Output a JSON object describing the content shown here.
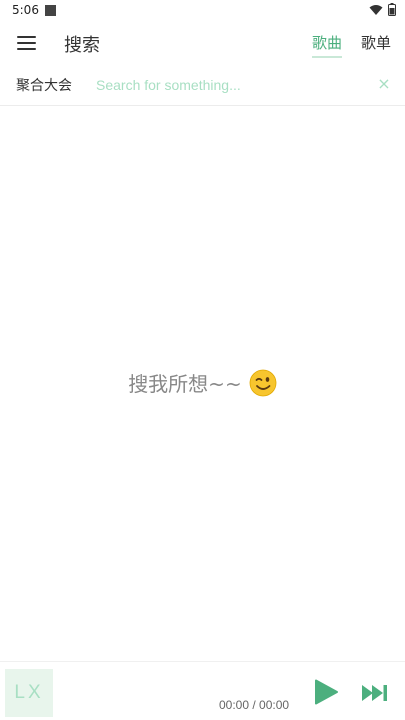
{
  "status_bar": {
    "time": "5:06"
  },
  "header": {
    "title": "搜索",
    "tabs": [
      {
        "label": "歌曲",
        "active": true
      },
      {
        "label": "歌单",
        "active": false
      }
    ]
  },
  "search": {
    "source": "聚合大会",
    "value": "",
    "placeholder": "Search for something...",
    "clear_glyph": "×"
  },
  "empty_state": {
    "message": "搜我所想~~"
  },
  "player": {
    "cover_text": "LX",
    "current_time": "00:00",
    "separator": " / ",
    "total_time": "00:00"
  },
  "colors": {
    "accent": "#4caf7e",
    "accent_light": "#a8dfc3",
    "cover_bg": "#e8f5ec"
  },
  "icons": {
    "menu": "hamburger-menu-icon",
    "clear": "close-icon",
    "emoji": "winking-face-icon",
    "play": "play-icon",
    "next": "skip-next-icon"
  }
}
